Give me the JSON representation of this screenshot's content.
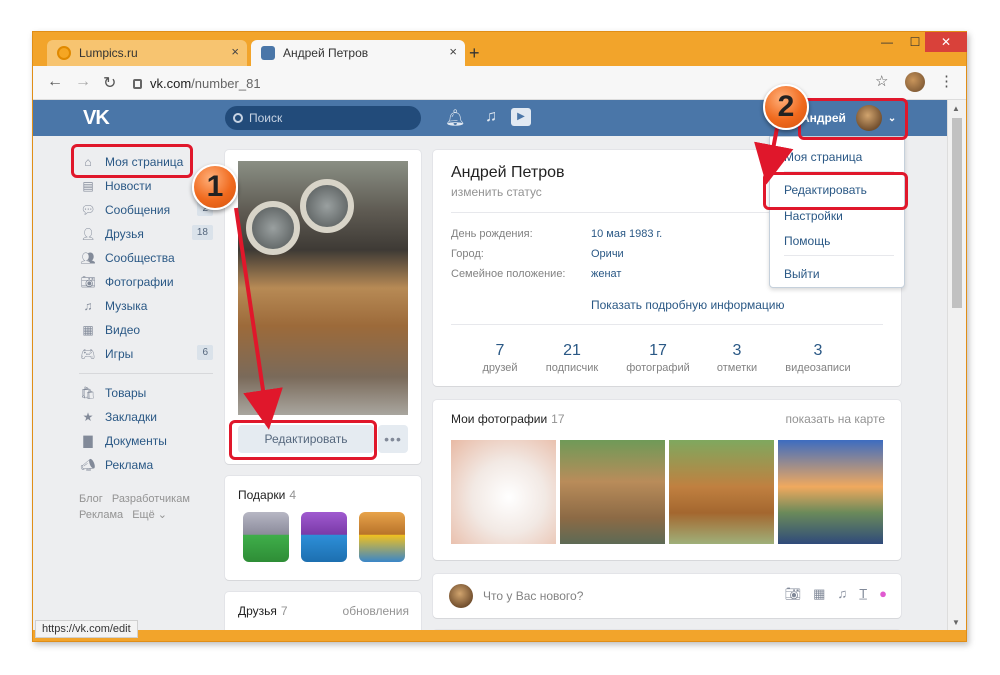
{
  "browser": {
    "tabs": [
      {
        "title": "Lumpics.ru",
        "close": "×"
      },
      {
        "title": "Андрей Петров",
        "close": "×"
      }
    ],
    "new_tab": "+",
    "window_controls": {
      "minimize": "—",
      "maximize": "☐",
      "close": "✕"
    },
    "url_host": "vk.com",
    "url_path": "/number_81",
    "status_url": "https://vk.com/edit"
  },
  "vk_header": {
    "logo": "VK",
    "search_placeholder": "Поиск",
    "user_name": "Андрей"
  },
  "left_nav": {
    "items": [
      {
        "label": "Моя страница",
        "icon": "home-icon",
        "count": ""
      },
      {
        "label": "Новости",
        "icon": "news-icon",
        "count": ""
      },
      {
        "label": "Сообщения",
        "icon": "messages-icon",
        "count": "2"
      },
      {
        "label": "Друзья",
        "icon": "friends-icon",
        "count": "18"
      },
      {
        "label": "Сообщества",
        "icon": "groups-icon",
        "count": ""
      },
      {
        "label": "Фотографии",
        "icon": "camera-icon",
        "count": ""
      },
      {
        "label": "Музыка",
        "icon": "music-icon",
        "count": ""
      },
      {
        "label": "Видео",
        "icon": "video-icon",
        "count": ""
      },
      {
        "label": "Игры",
        "icon": "gamepad-icon",
        "count": "6"
      }
    ],
    "items2": [
      {
        "label": "Товары",
        "icon": "bag-icon"
      },
      {
        "label": "Закладки",
        "icon": "star-icon"
      },
      {
        "label": "Документы",
        "icon": "document-icon"
      },
      {
        "label": "Реклама",
        "icon": "megaphone-icon"
      }
    ],
    "footer": [
      "Блог",
      "Разработчикам",
      "Реклама",
      "Ещё ⌄"
    ]
  },
  "avatar_card": {
    "edit_label": "Редактировать",
    "more_label": "•••"
  },
  "gifts": {
    "title": "Подарки",
    "count": "4"
  },
  "friends": {
    "title": "Друзья",
    "count": "7",
    "link": "обновления"
  },
  "profile": {
    "name": "Андрей Петров",
    "status": "изменить статус",
    "rows": [
      {
        "label": "День рождения:",
        "value": "10 мая 1983 г."
      },
      {
        "label": "Город:",
        "value": "Оричи"
      },
      {
        "label": "Семейное положение:",
        "value": "женат"
      }
    ],
    "show_more": "Показать подробную информацию",
    "stats": [
      {
        "n": "7",
        "l": "друзей"
      },
      {
        "n": "21",
        "l": "подписчик"
      },
      {
        "n": "17",
        "l": "фотографий"
      },
      {
        "n": "3",
        "l": "отметки"
      },
      {
        "n": "3",
        "l": "видеозаписи"
      }
    ]
  },
  "photos": {
    "title": "Мои фотографии",
    "count": "17",
    "link": "показать на карте"
  },
  "post": {
    "placeholder": "Что у Вас нового?"
  },
  "dropdown": {
    "items": [
      "Моя страница",
      "Редактировать",
      "Настройки",
      "Помощь",
      "Выйти"
    ]
  },
  "annotations": {
    "step1": "1",
    "step2": "2"
  },
  "colors": {
    "accent": "#4a76a8",
    "link": "#2a5885",
    "highlight": "#e0172b",
    "browser_frame": "#f2a42b"
  }
}
